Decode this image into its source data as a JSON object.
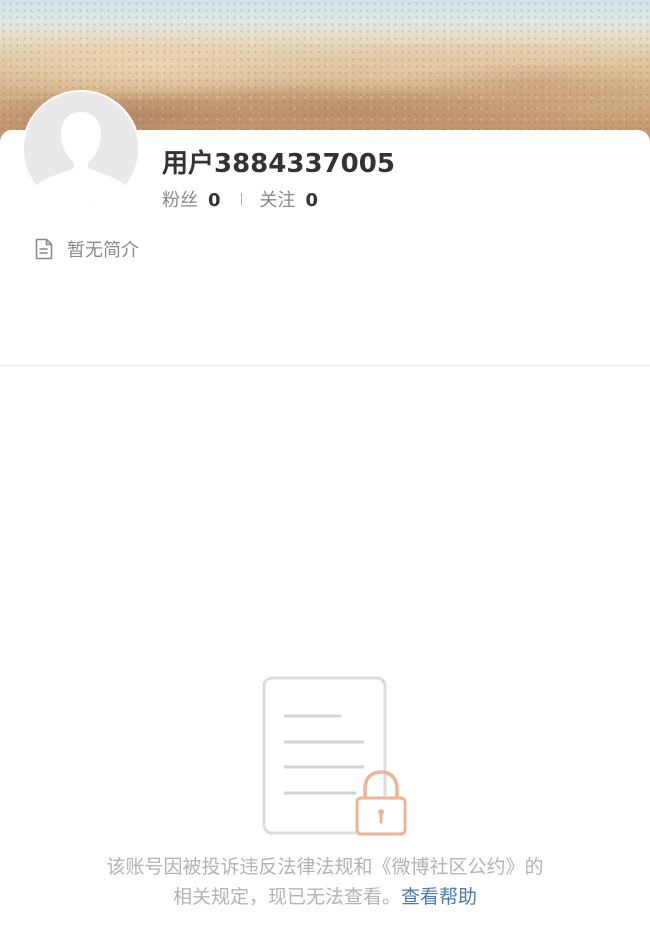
{
  "profile": {
    "username": "用户3884337005",
    "stats": {
      "followers_label": "粉丝",
      "followers_count": "0",
      "following_label": "关注",
      "following_count": "0"
    },
    "intro": {
      "icon": "document-icon",
      "text": "暂无简介"
    }
  },
  "blocked_notice": {
    "illustration": "locked-document-icon",
    "line1": "该账号因被投诉违反法律法规和《微博社区公约》的",
    "line2": "相关规定，现已无法查看。",
    "help_link": "查看帮助"
  },
  "colors": {
    "link": "#4c7ab1",
    "lock": "#f2b48e",
    "muted_text": "#b3b3b3"
  }
}
